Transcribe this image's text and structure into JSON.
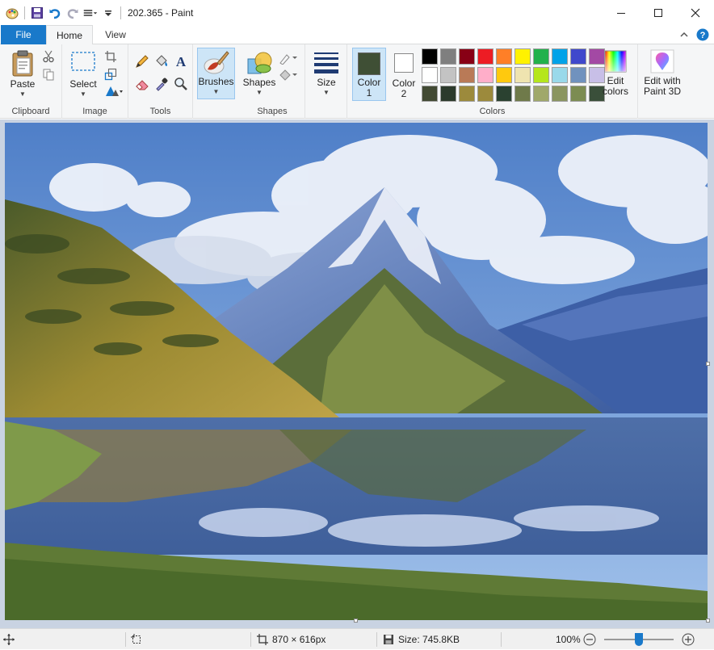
{
  "window": {
    "title": "202.365 - Paint"
  },
  "tabs": {
    "file": "File",
    "home": "Home",
    "view": "View"
  },
  "ribbon": {
    "clipboard": {
      "paste": "Paste",
      "group": "Clipboard"
    },
    "image": {
      "select": "Select",
      "group": "Image"
    },
    "tools": {
      "group": "Tools"
    },
    "brushes": {
      "label": "Brushes"
    },
    "shapes": {
      "label": "Shapes",
      "group": "Shapes"
    },
    "size": {
      "label": "Size"
    },
    "colors": {
      "color1_line1": "Color",
      "color1_line2": "1",
      "color2_line1": "Color",
      "color2_line2": "2",
      "edit_line1": "Edit",
      "edit_line2": "colors",
      "paint3d_line1": "Edit with",
      "paint3d_line2": "Paint 3D",
      "group": "Colors",
      "color1_value": "#3f4f35",
      "color2_value": "#ffffff",
      "palette": [
        "#000000",
        "#7f7f7f",
        "#880015",
        "#ed1c24",
        "#ff7f27",
        "#fff200",
        "#22b14c",
        "#00a2e8",
        "#3f48cc",
        "#a349a4",
        "#ffffff",
        "#c3c3c3",
        "#b97a57",
        "#ffaec9",
        "#ffc90e",
        "#efe4b0",
        "#b5e61d",
        "#99d9ea",
        "#7092be",
        "#c8bfe7",
        "#424a33",
        "#2c3a2c",
        "#9c8a3c",
        "#9c8a3c",
        "#2a4130",
        "#6f7a4a",
        "#a0a86a",
        "#8a9560",
        "#7c8c52",
        "#3a4f3a"
      ]
    }
  },
  "status": {
    "dimensions": "870 × 616px",
    "size": "Size: 745.8KB",
    "zoom": "100%"
  }
}
